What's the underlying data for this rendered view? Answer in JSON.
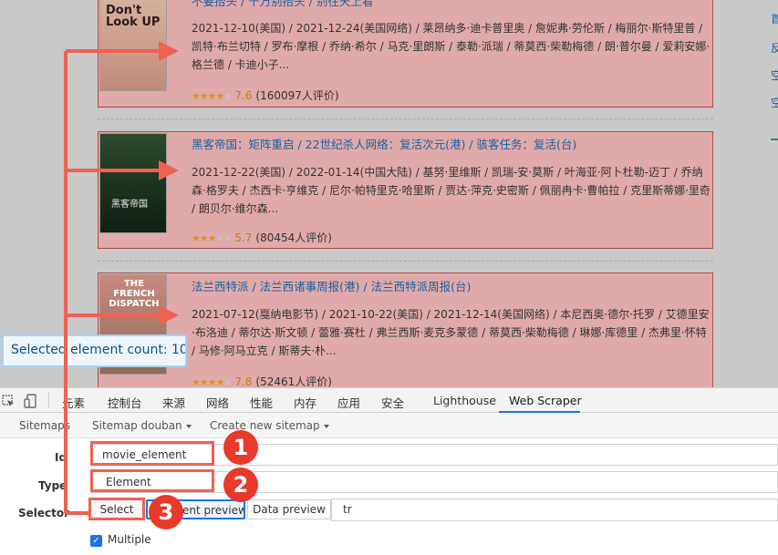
{
  "movies": [
    {
      "title": "不要抬头 / 千万别抬头 / 别往天上看",
      "info": "2021-12-10(美国) / 2021-12-24(美国网络) / 莱昂纳多·迪卡普里奥 / 詹妮弗·劳伦斯 / 梅丽尔·斯特里普 / 凯特·布兰切特 / 罗布·摩根 / 乔纳·希尔 / 马克·里朗斯 / 泰勒·派瑞 / 蒂莫西·柴勒梅德 / 朗·普尔曼 / 爱莉安娜·格兰德 / 卡迪小子...",
      "score": "7.6",
      "votes": "(160097人评价)",
      "stars_fill": 0.76,
      "poster_text": "Don't Look UP"
    },
    {
      "title": "黑客帝国：矩阵重启 / 22世纪杀人网络：复活次元(港) / 骇客任务：复活(台)",
      "info": "2021-12-22(美国) / 2022-01-14(中国大陆) / 基努·里维斯 / 凯瑞-安·莫斯 / 叶海亚·阿卜杜勒-迈丁 / 乔纳森·格罗夫 / 杰西卡·亨维克 / 尼尔·帕特里克·哈里斯 / 贾达·萍克·史密斯 / 佩丽冉卡·曹帕拉 / 克里斯蒂娜·里奇 / 朗贝尔·维尔森...",
      "score": "5.7",
      "votes": "(80454人评价)",
      "stars_fill": 0.57,
      "poster_text": "黑客帝国"
    },
    {
      "title": "法兰西特派 / 法兰西诸事周报(港) / 法兰西特派周报(台)",
      "info": "2021-07-12(戛纳电影节) / 2021-10-22(美国) / 2021-12-14(美国网络) / 本尼西奥·德尔·托罗 / 艾德里安·布洛迪 / 蒂尔达·斯文顿 / 蕾雅·赛杜 / 弗兰西斯·麦克多蒙德 / 蒂莫西·柴勒梅德 / 琳娜·库德里 / 杰弗里·怀特 / 马修·阿马立克 / 斯蒂夫·朴...",
      "score": "7.8",
      "votes": "(52461人评价)",
      "stars_fill": 0.78,
      "poster_text": "THE FRENCH DISPATCH"
    }
  ],
  "selected_count": "Selected element count: 10",
  "devtools_tabs": [
    "元素",
    "控制台",
    "来源",
    "网络",
    "性能",
    "内存",
    "应用",
    "安全",
    "Lighthouse",
    "Web Scraper"
  ],
  "scraper_nav": {
    "sitemaps": "Sitemaps",
    "sitemap_current": "Sitemap douban",
    "create_new": "Create new sitemap"
  },
  "form": {
    "id_label": "Id",
    "id_value": "movie_element",
    "type_label": "Type",
    "type_value": "Element",
    "selector_label": "Selector",
    "select_btn": "Select",
    "element_preview_btn": "Element preview",
    "data_preview_btn": "Data preview",
    "selector_value": "tr",
    "multiple_label": "Multiple"
  },
  "badges": [
    "1",
    "2",
    "3"
  ],
  "right_links": [
    "首",
    "反",
    "空"
  ],
  "colors": {
    "highlight": "#f06152",
    "badge": "#e8392b",
    "selection_fill": "#e0aaaa",
    "link": "#1a5fa0"
  }
}
